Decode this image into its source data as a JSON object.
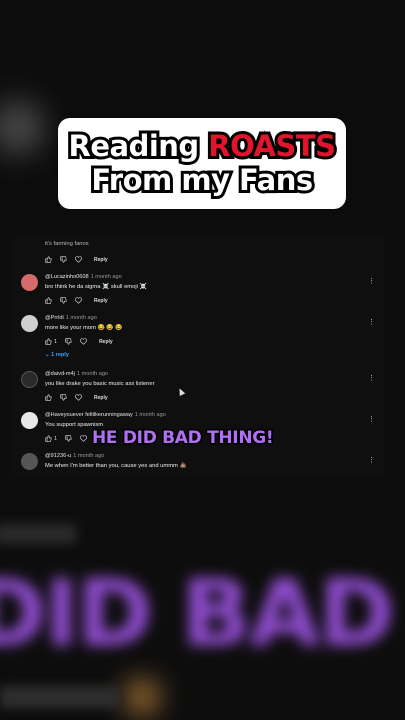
{
  "title": {
    "line1_plain": "Reading ",
    "line1_highlight": "ROASTS",
    "line2": "From my Fans",
    "highlight_color": "#e0142a"
  },
  "overlay_caption": "HE DID BAD THING!",
  "background_caption": "DID BAD THI",
  "comments": [
    {
      "author": "",
      "ago": "",
      "text": "it's farming fanos",
      "likes": "",
      "reply_label": "Reply",
      "avatar_color": "#000000"
    },
    {
      "author": "@Lucazinho0608",
      "ago": "1 month ago",
      "text": "bro think he da sigma ☠️ skull emoji ☠️",
      "likes": "",
      "reply_label": "Reply",
      "avatar_color": "#d46a6a"
    },
    {
      "author": "@Prrldi",
      "ago": "1 month ago",
      "text": "more like your mom 😂 😂 😂",
      "likes": "1",
      "reply_label": "Reply",
      "replies": "1 reply",
      "avatar_color": "#cfcfcf"
    },
    {
      "author": "@daivd-m4j",
      "ago": "1 month ago",
      "text": "you like drake you basic music ass listener",
      "likes": "",
      "reply_label": "Reply",
      "avatar_color": "#2a2a2a"
    },
    {
      "author": "@Haveyouever feltlikerunningaway",
      "ago": "1 month ago",
      "text": "You support spawnism",
      "likes": "1",
      "reply_label": "Reply",
      "avatar_color": "#e8e8e8"
    },
    {
      "author": "@91236-u",
      "ago": "1 month ago",
      "text": "Me when I'm better than you, cause yes and ummm 💩",
      "likes": "",
      "reply_label": "",
      "avatar_color": "#555555"
    }
  ],
  "icons": {
    "like": "thumbs-up-icon",
    "dislike": "thumbs-down-icon",
    "heart": "heart-icon",
    "menu": "more-vertical-icon",
    "expand": "chevron-down-icon"
  }
}
